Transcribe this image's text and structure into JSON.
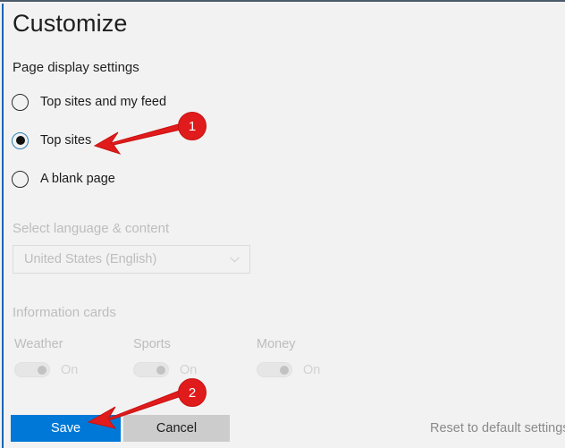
{
  "window": {
    "title": "Customize",
    "background_color": "#f2f2f2",
    "accent_color": "#0078d7",
    "left_rail_color": "#1464b4"
  },
  "page_display": {
    "heading": "Page display settings",
    "options": [
      {
        "label": "Top sites and my feed",
        "selected": false
      },
      {
        "label": "Top sites",
        "selected": true
      },
      {
        "label": "A blank page",
        "selected": false
      }
    ]
  },
  "language": {
    "heading": "Select language & content",
    "disabled": true,
    "selected_value": "United States (English)",
    "chevron_icon": "chevron-down-icon"
  },
  "information_cards": {
    "heading": "Information cards",
    "disabled": true,
    "cards": [
      {
        "label": "Weather",
        "state": "On"
      },
      {
        "label": "Sports",
        "state": "On"
      },
      {
        "label": "Money",
        "state": "On"
      }
    ]
  },
  "footer": {
    "save_label": "Save",
    "cancel_label": "Cancel",
    "reset_label": "Reset to default settings"
  },
  "annotations": {
    "badge_color": "#e01b1b",
    "markers": [
      {
        "number": "1",
        "points_at": "Top sites radio button"
      },
      {
        "number": "2",
        "points_at": "Save button"
      }
    ]
  }
}
